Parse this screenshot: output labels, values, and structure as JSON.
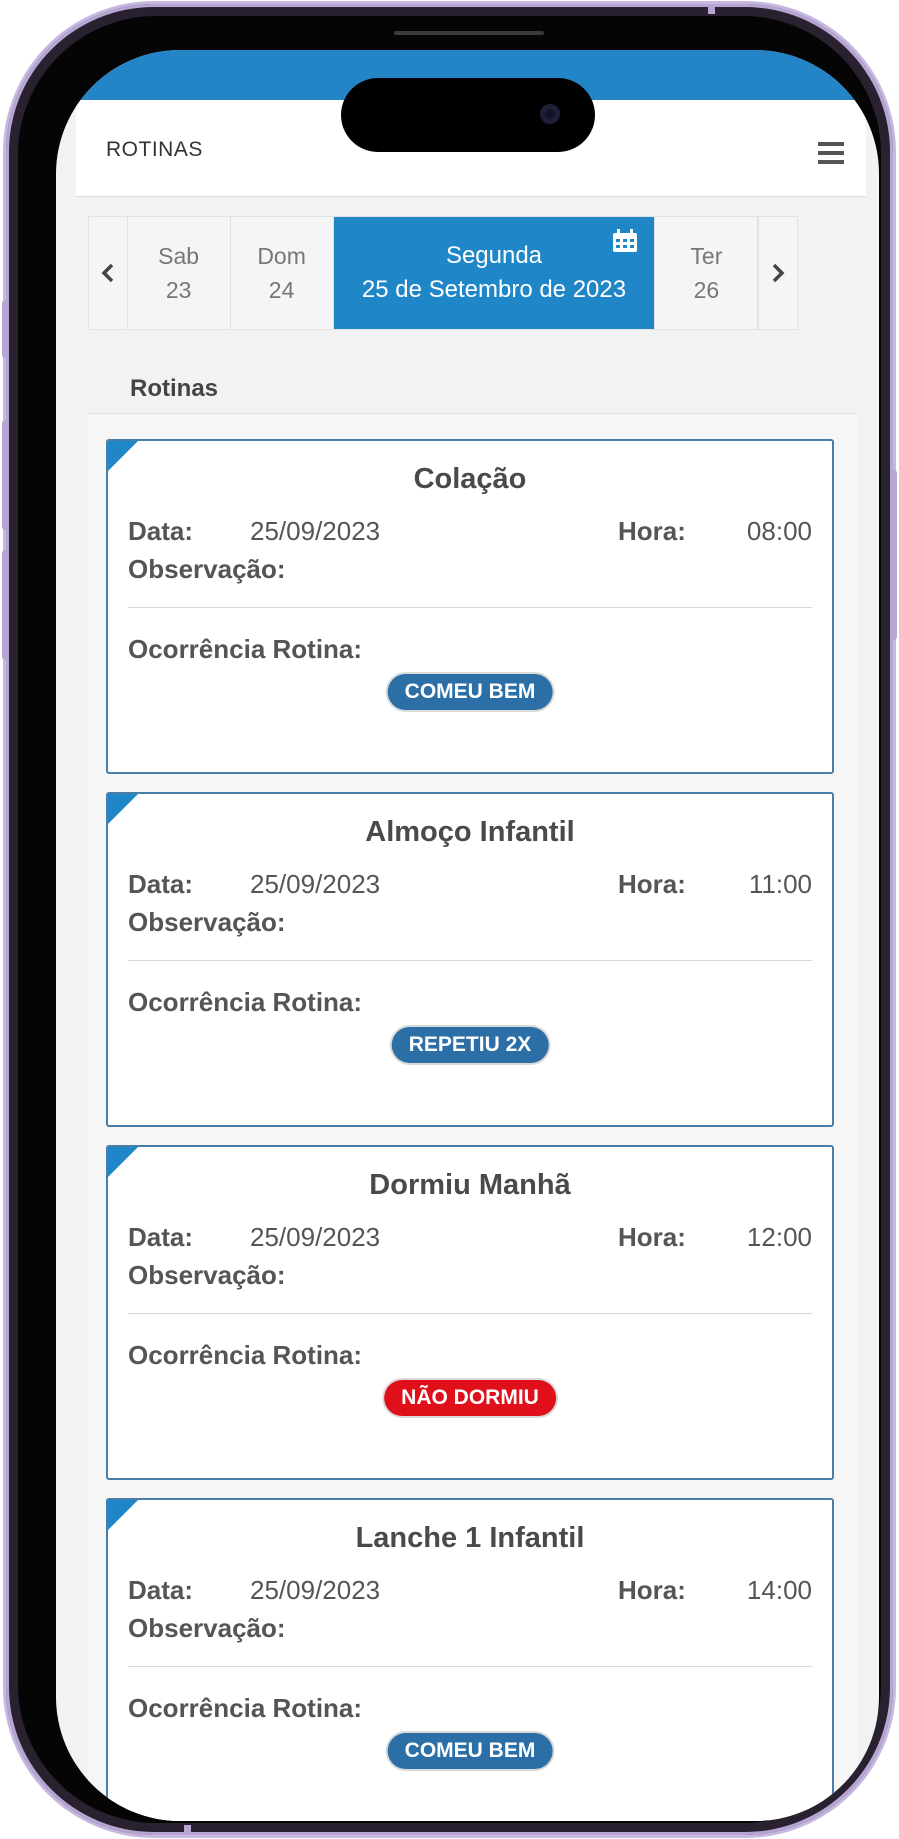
{
  "colors": {
    "accent": "#1f86c8",
    "status_bar": "#2384c6",
    "badge_blue": "#2c6ea6",
    "badge_red": "#e0101a",
    "card_border": "#4b7ea6"
  },
  "header": {
    "title": "ROTINAS",
    "menu_icon": "hamburger-menu-icon"
  },
  "day_selector": {
    "prev_icon": "chevron-left-icon",
    "next_icon": "chevron-right-icon",
    "calendar_icon": "calendar-icon",
    "days": [
      {
        "weekday": "Sab",
        "date": "23"
      },
      {
        "weekday": "Dom",
        "date": "24"
      },
      {
        "weekday": "Segunda",
        "date": "25 de Setembro de 2023",
        "active": true
      },
      {
        "weekday": "Ter",
        "date": "26"
      }
    ]
  },
  "section": {
    "title": "Rotinas"
  },
  "labels": {
    "data": "Data:",
    "hora": "Hora:",
    "observacao": "Observação:",
    "ocorrencia": "Ocorrência Rotina:"
  },
  "routines": [
    {
      "title": "Colação",
      "date": "25/09/2023",
      "time": "08:00",
      "observation": "",
      "occurrence": "COMEU BEM",
      "occurrence_color": "#2c6ea6"
    },
    {
      "title": "Almoço Infantil",
      "date": "25/09/2023",
      "time": "11:00",
      "observation": "",
      "occurrence": "REPETIU 2X",
      "occurrence_color": "#2c6ea6"
    },
    {
      "title": "Dormiu Manhã",
      "date": "25/09/2023",
      "time": "12:00",
      "observation": "",
      "occurrence": "NÃO DORMIU",
      "occurrence_color": "#e0101a"
    },
    {
      "title": "Lanche 1 Infantil",
      "date": "25/09/2023",
      "time": "14:00",
      "observation": "",
      "occurrence": "COMEU BEM",
      "occurrence_color": "#2c6ea6"
    }
  ]
}
